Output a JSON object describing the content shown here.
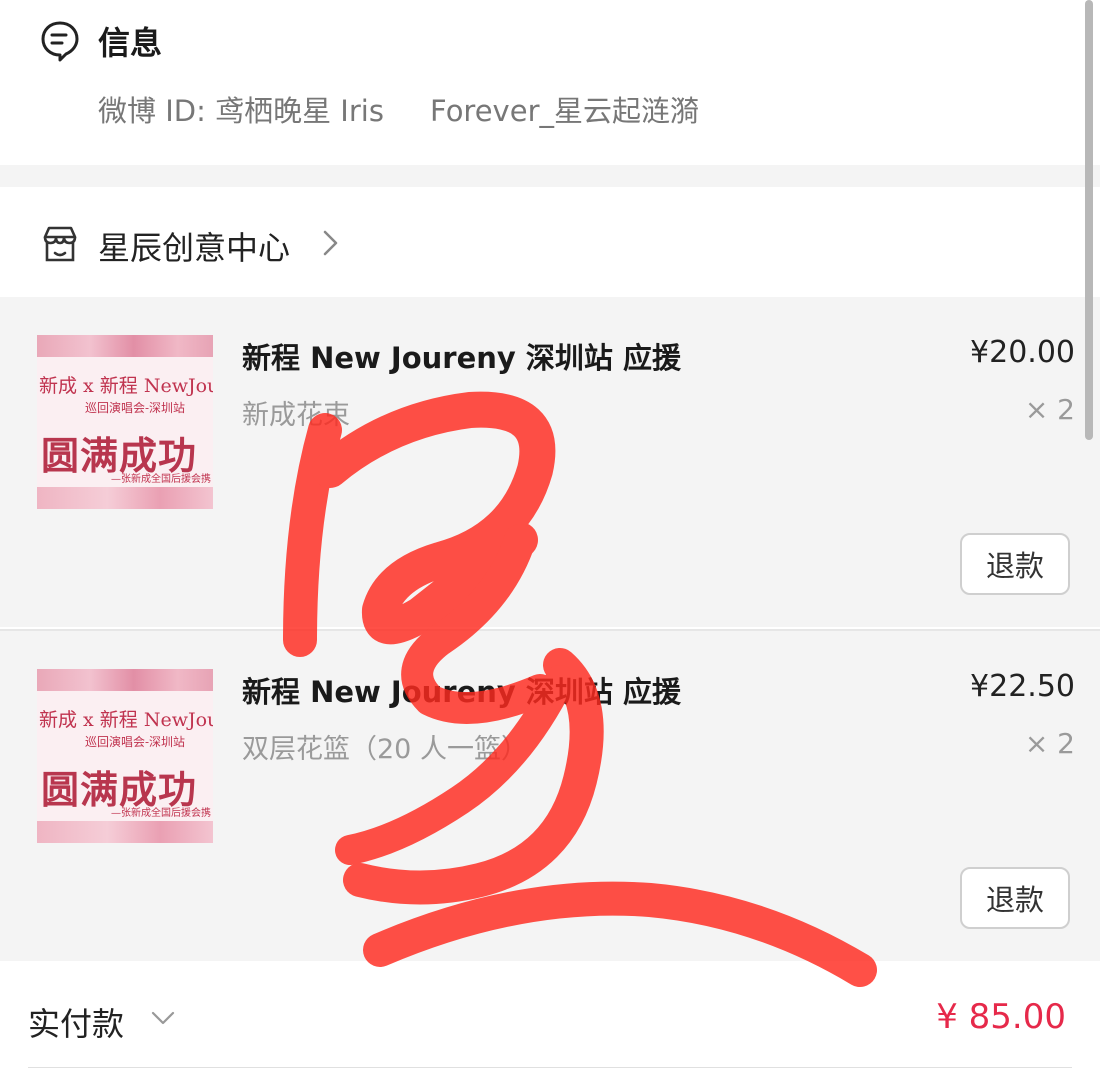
{
  "info": {
    "icon": "message-icon",
    "title": "信息",
    "text": "微博 ID: 鸢栖晚星 Iris     Forever_星云起涟漪"
  },
  "shop": {
    "icon": "store-icon",
    "name": "星辰创意中心",
    "chevron": "chevron-right-icon"
  },
  "items": [
    {
      "title": "新程 New Joureny 深圳站 应援",
      "spec": "新成花束",
      "price": "¥20.00",
      "qty": "× 2",
      "refund_label": "退款",
      "thumb": {
        "line1": "新成 x 新程 NewJourne",
        "line2": "巡回演唱会-深圳站",
        "line3": "圆满成功",
        "line4": "—张新成全国后援会携"
      }
    },
    {
      "title": "新程 New Joureny 深圳站 应援",
      "spec": "双层花篮（20 人一篮）",
      "price": "¥22.50",
      "qty": "× 2",
      "refund_label": "退款",
      "thumb": {
        "line1": "新成 x 新程 NewJourne",
        "line2": "巡回演唱会-深圳站",
        "line3": "圆满成功",
        "line4": "—张新成全国后援会携"
      }
    }
  ],
  "total": {
    "label": "实付款",
    "chevron": "chevron-down-icon",
    "amount": "¥ 85.00"
  },
  "colors": {
    "accent_red": "#e6294a",
    "watermark_red": "#ff2a1f",
    "section_gray": "#f4f4f4"
  }
}
